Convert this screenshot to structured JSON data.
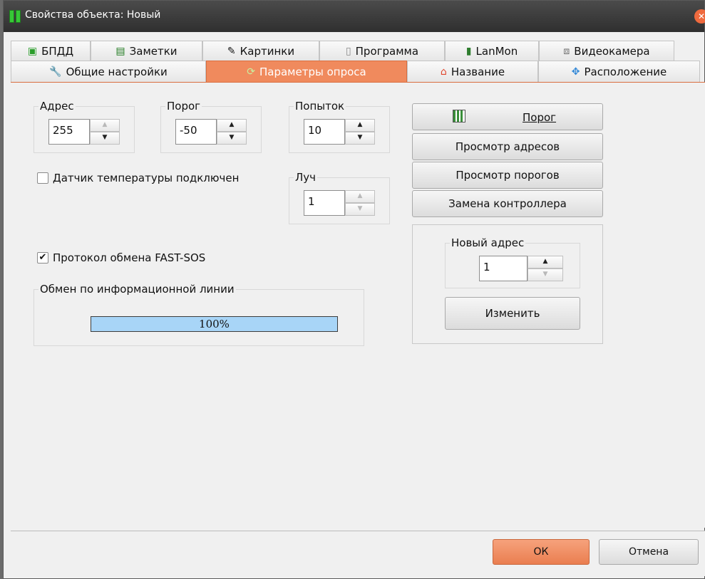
{
  "window": {
    "title": "Свойства объекта: Новый"
  },
  "tabs_row1": [
    {
      "label": "БПДД",
      "icon": "bpdd-icon"
    },
    {
      "label": "Заметки",
      "icon": "notes-icon"
    },
    {
      "label": "Картинки",
      "icon": "pictures-icon"
    },
    {
      "label": "Программа",
      "icon": "program-icon"
    },
    {
      "label": "LanMon",
      "icon": "lanmon-icon"
    },
    {
      "label": "Видеокамера",
      "icon": "camera-icon"
    }
  ],
  "tabs_row2": [
    {
      "label": "Общие настройки",
      "icon": "wrench-icon"
    },
    {
      "label": "Параметры опроса",
      "icon": "refresh-icon",
      "active": true
    },
    {
      "label": "Название",
      "icon": "home-icon"
    },
    {
      "label": "Расположение",
      "icon": "move-icon"
    }
  ],
  "address": {
    "label": "Адрес",
    "value": "255"
  },
  "threshold": {
    "label": "Порог",
    "value": "-50"
  },
  "attempts": {
    "label": "Попыток",
    "value": "10"
  },
  "temp_sensor": {
    "label": "Датчик температуры подключен",
    "checked": false
  },
  "beam": {
    "label": "Луч",
    "value": "1"
  },
  "fast_sos": {
    "label": "Протокол обмена FAST-SOS",
    "checked": true
  },
  "exchange": {
    "label": "Обмен по информационной линии",
    "progress_text": "100%",
    "progress": 1.0
  },
  "buttons": {
    "threshold": "Порог",
    "view_addresses": "Просмотр адресов",
    "view_thresholds": "Просмотр порогов",
    "replace_controller": "Замена контроллера",
    "change": "Изменить",
    "ok": "ОК",
    "cancel": "Отмена"
  },
  "new_address": {
    "label": "Новый адрес",
    "value": "1"
  },
  "colors": {
    "accent": "#f08a5d",
    "progress_fill": "#a8d5f7",
    "titlebar": "#3a3a3a"
  }
}
